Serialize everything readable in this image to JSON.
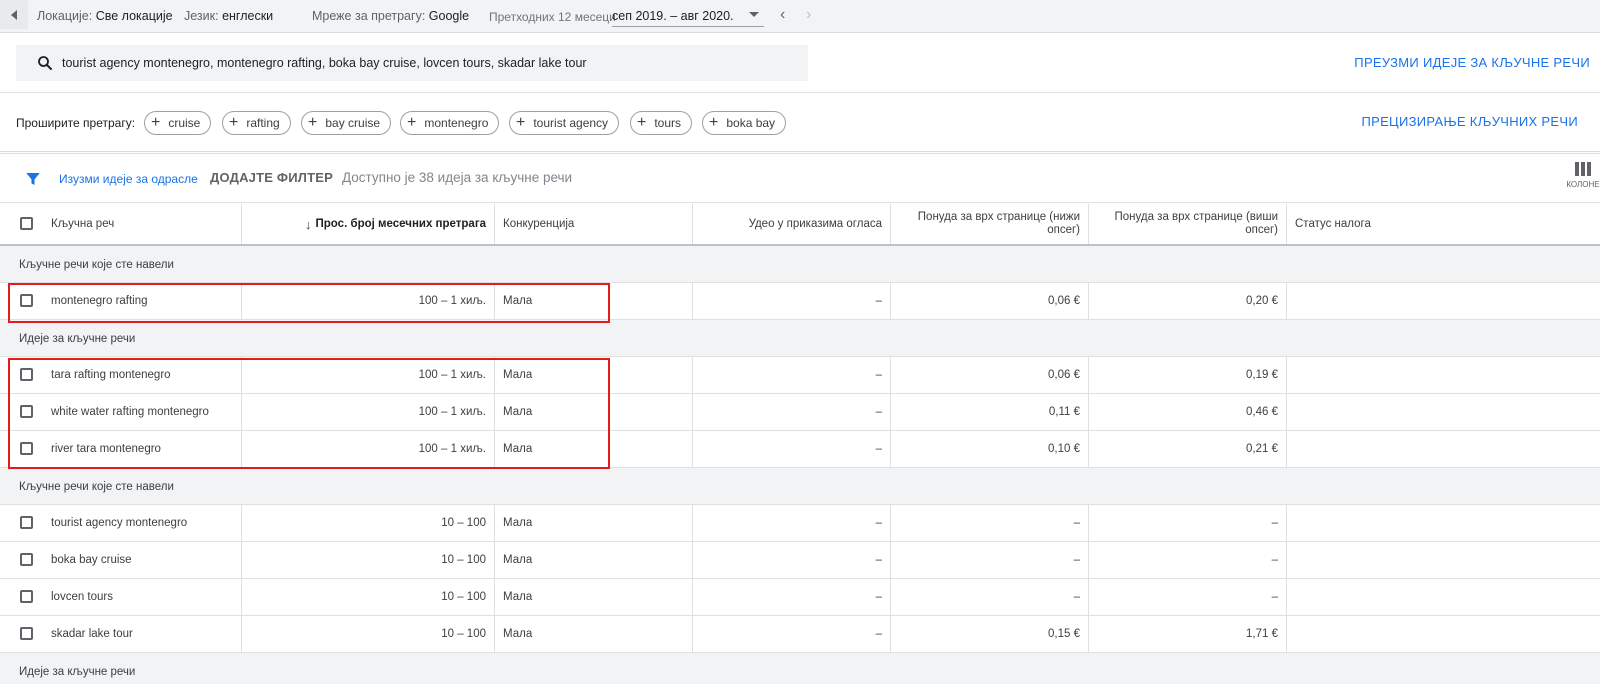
{
  "topbar": {
    "locations_label": "Локације:",
    "locations_value": "Све локације",
    "language_label": "Језик:",
    "language_value": "енглески",
    "networks_label": "Мреже за претрагу:",
    "networks_value": "Google",
    "period_label": "Претходних 12 месеци",
    "period_value": "сеп 2019. – авг 2020."
  },
  "search": {
    "query": "tourist agency montenegro, montenegro rafting, boka bay cruise, lovcen tours, skadar lake tour",
    "download_label": "ПРЕУЗМИ ИДЕЈЕ ЗА КЉУЧНЕ РЕЧИ"
  },
  "expand": {
    "label": "Проширите претрагу:",
    "chips": [
      "cruise",
      "rafting",
      "bay cruise",
      "montenegro",
      "tourist agency",
      "tours",
      "boka bay"
    ],
    "refine_label": "ПРЕЦИЗИРАЊЕ КЉУЧНИХ РЕЧИ"
  },
  "filter_bar": {
    "exclude_adult": "Изузми идеје за одрасле",
    "add_filter": "ДОДАЈТЕ ФИЛТЕР",
    "available": "Доступно је 38 идеја за кључне речи",
    "columns_label": "КОЛОНЕ"
  },
  "table": {
    "headers": {
      "keyword": "Кључна реч",
      "avg_searches": "Прос. број месечних претрага",
      "competition": "Конкуренција",
      "impression_share": "Удео у приказима огласа",
      "bid_low": "Понуда за врх странице (нижи опсег)",
      "bid_high": "Понуда за врх странице (виши опсег)",
      "account_status": "Статус налога"
    },
    "groups": [
      {
        "label": "Кључне речи које сте навели",
        "rows": [
          {
            "keyword": "montenegro rafting",
            "searches": "100 – 1 хиљ.",
            "competition": "Мала",
            "share": "–",
            "bid_low": "0,06 €",
            "bid_high": "0,20 €"
          }
        ]
      },
      {
        "label": "Идеје за кључне речи",
        "rows": [
          {
            "keyword": "tara rafting montenegro",
            "searches": "100 – 1 хиљ.",
            "competition": "Мала",
            "share": "–",
            "bid_low": "0,06 €",
            "bid_high": "0,19 €"
          },
          {
            "keyword": "white water rafting montenegro",
            "searches": "100 – 1 хиљ.",
            "competition": "Мала",
            "share": "–",
            "bid_low": "0,11 €",
            "bid_high": "0,46 €"
          },
          {
            "keyword": "river tara montenegro",
            "searches": "100 – 1 хиљ.",
            "competition": "Мала",
            "share": "–",
            "bid_low": "0,10 €",
            "bid_high": "0,21 €"
          }
        ]
      },
      {
        "label": "Кључне речи које сте навели",
        "rows": [
          {
            "keyword": "tourist agency montenegro",
            "searches": "10 – 100",
            "competition": "Мала",
            "share": "–",
            "bid_low": "–",
            "bid_high": "–"
          },
          {
            "keyword": "boka bay cruise",
            "searches": "10 – 100",
            "competition": "Мала",
            "share": "–",
            "bid_low": "–",
            "bid_high": "–"
          },
          {
            "keyword": "lovcen tours",
            "searches": "10 – 100",
            "competition": "Мала",
            "share": "–",
            "bid_low": "–",
            "bid_high": "–"
          },
          {
            "keyword": "skadar lake tour",
            "searches": "10 – 100",
            "competition": "Мала",
            "share": "–",
            "bid_low": "0,15 €",
            "bid_high": "1,71 €"
          }
        ]
      },
      {
        "label": "Идеје за кључне речи",
        "rows": []
      }
    ]
  },
  "colors": {
    "accent": "#1a73e8",
    "highlight": "#e31b1b",
    "group_bg": "#f1f3f4"
  }
}
